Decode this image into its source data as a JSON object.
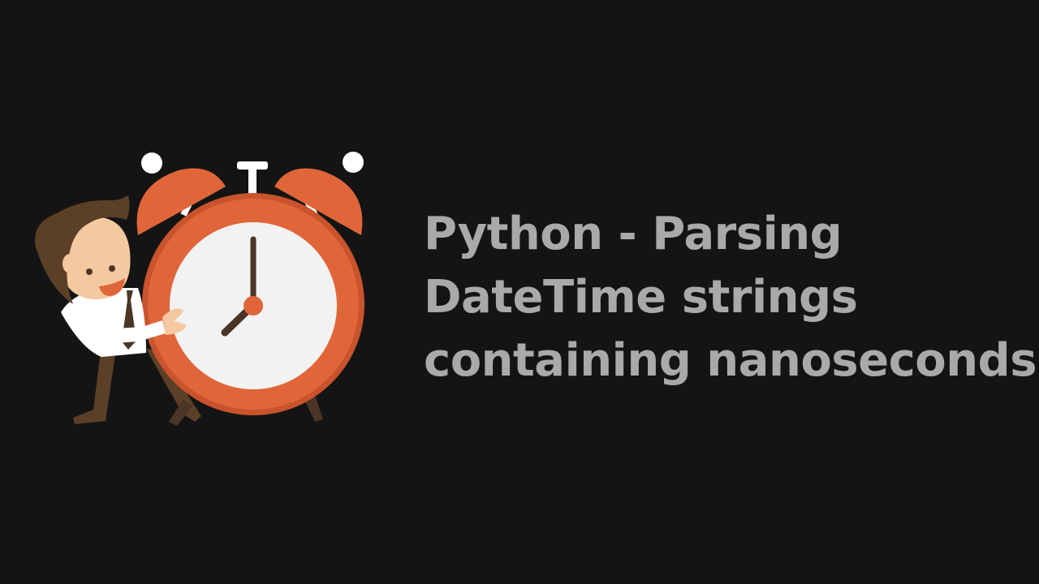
{
  "page": {
    "background": "#141414"
  },
  "title": {
    "lines": [
      "Python - Parsing",
      "DateTime strings",
      "containing nanoseconds"
    ],
    "color": "#a9a9a9"
  },
  "illustration": {
    "subject": "cartoon businessman hugging alarm clock",
    "colors": {
      "clock_body": "#e0663a",
      "clock_body_dark": "#c8532c",
      "clock_face": "#f2f2f2",
      "hands": "#4a3526",
      "hub": "#e0663a",
      "bell_knobs": "#ffffff",
      "hair": "#5b4027",
      "skin": "#f4c9a0",
      "shirt": "#ffffff",
      "tie": "#4a3526",
      "trousers": "#5b4027"
    }
  }
}
